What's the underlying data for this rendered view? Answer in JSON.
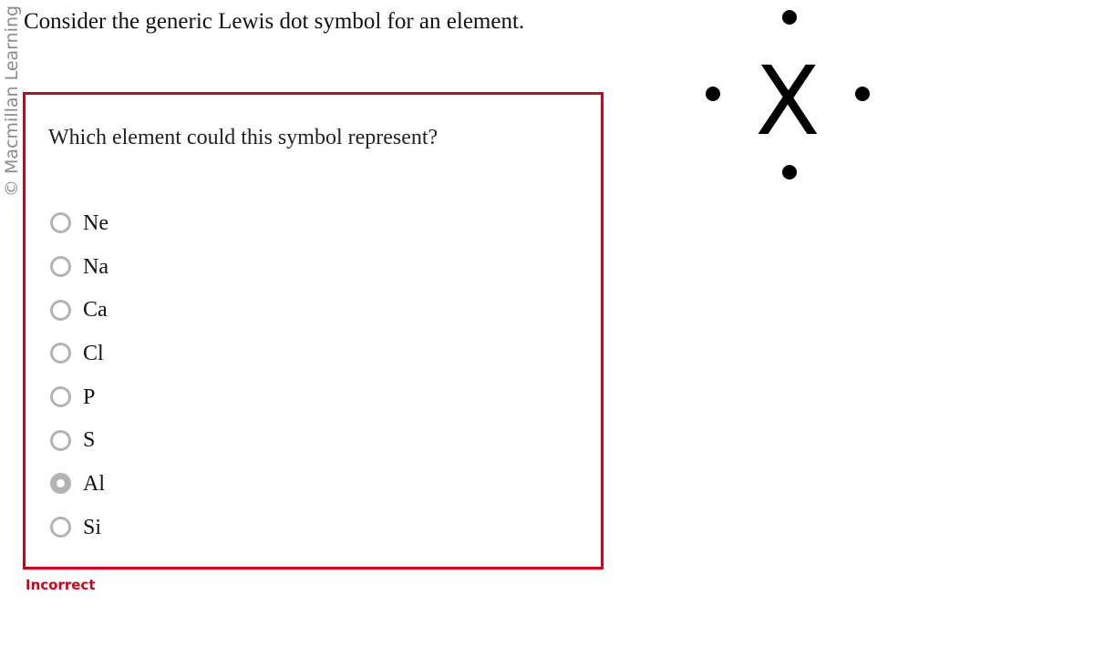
{
  "copyright": "© Macmillan Learning",
  "intro": "Consider the generic Lewis dot symbol for an element.",
  "lewis_symbol": {
    "symbol": "X",
    "dots": [
      "top",
      "left",
      "right",
      "bottom"
    ],
    "dot_count": 4
  },
  "question": {
    "prompt": "Which element could this symbol represent?",
    "options": [
      {
        "label": "Ne",
        "selected": false
      },
      {
        "label": "Na",
        "selected": false
      },
      {
        "label": "Ca",
        "selected": false
      },
      {
        "label": "Cl",
        "selected": false
      },
      {
        "label": "P",
        "selected": false
      },
      {
        "label": "S",
        "selected": false
      },
      {
        "label": "Al",
        "selected": true
      },
      {
        "label": "Si",
        "selected": false
      }
    ],
    "selected": "Al"
  },
  "feedback": {
    "text": "Incorrect",
    "color": "#d0021b"
  },
  "colors": {
    "box_border": "#d0021b",
    "radio_border": "#b3b3b3"
  }
}
